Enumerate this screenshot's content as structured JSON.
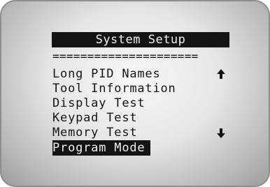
{
  "screen": {
    "title": "System Setup",
    "divider": "====================="
  },
  "menu": {
    "items": [
      {
        "label": "Long PID Names"
      },
      {
        "label": "Tool Information"
      },
      {
        "label": "Display Test"
      },
      {
        "label": "Keypad Test"
      },
      {
        "label": "Memory Test"
      },
      {
        "label": "Program Mode",
        "selected": true
      }
    ]
  },
  "icons": {
    "scroll_up": "up-arrow-icon",
    "scroll_down": "down-arrow-icon"
  }
}
